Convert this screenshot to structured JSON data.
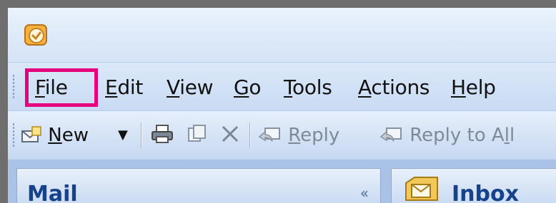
{
  "menubar": {
    "items": [
      {
        "accel": "F",
        "rest": "ile"
      },
      {
        "accel": "E",
        "rest": "dit"
      },
      {
        "accel": "V",
        "rest": "iew"
      },
      {
        "accel": "G",
        "rest": "o"
      },
      {
        "accel": "T",
        "rest": "ools"
      },
      {
        "accel": "A",
        "rest": "ctions"
      },
      {
        "accel": "H",
        "rest": "elp"
      }
    ],
    "highlight_color": "#e6007e"
  },
  "toolbar": {
    "new": {
      "accel": "N",
      "rest": "ew"
    },
    "reply": {
      "accel": "R",
      "rest": "eply"
    },
    "reply_all": {
      "pre": "Reply to A",
      "accel": "l",
      "rest": "l"
    },
    "icons": [
      "new-mail-icon",
      "dropdown-arrow-icon",
      "print-icon",
      "move-icon",
      "delete-icon",
      "reply-icon",
      "reply-all-icon"
    ]
  },
  "navigation_pane": {
    "title": "Mail",
    "collapse_glyph": "«"
  },
  "content_pane": {
    "title": "Inbox",
    "icon": "inbox-icon"
  }
}
